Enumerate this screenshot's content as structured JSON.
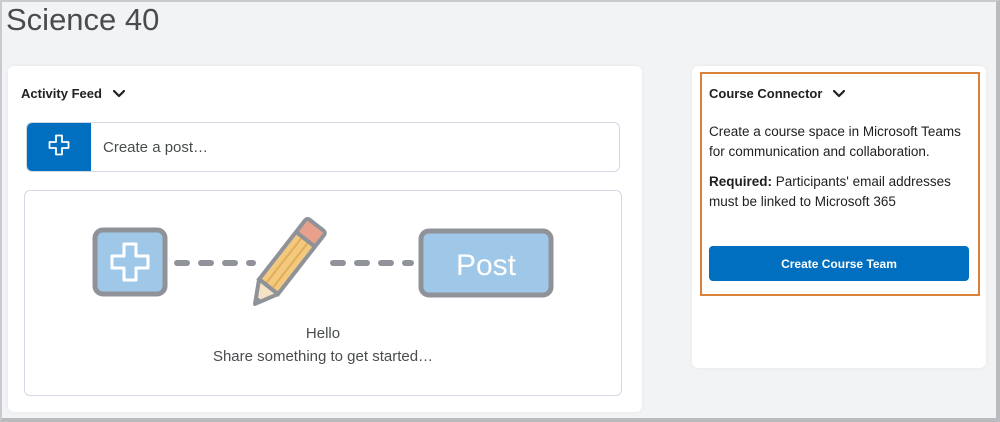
{
  "page": {
    "title": "Science 40"
  },
  "activity_feed": {
    "header": "Activity Feed",
    "add_icon": "plus-icon",
    "post_placeholder": "Create a post…",
    "illustration": {
      "post_label": "Post"
    },
    "empty_line1": "Hello",
    "empty_line2": "Share something to get started…"
  },
  "course_connector": {
    "header": "Course Connector",
    "description": "Create a course space in Microsoft Teams for communication and collaboration.",
    "required_label": "Required:",
    "required_text": " Participants' email addresses must be linked to Microsoft 365",
    "button_label": "Create Course Team"
  },
  "colors": {
    "primary": "#006fbf",
    "highlight_border": "#d9823b",
    "illustration_blue": "#9fc8e8",
    "illustration_gray": "#8f9399"
  }
}
